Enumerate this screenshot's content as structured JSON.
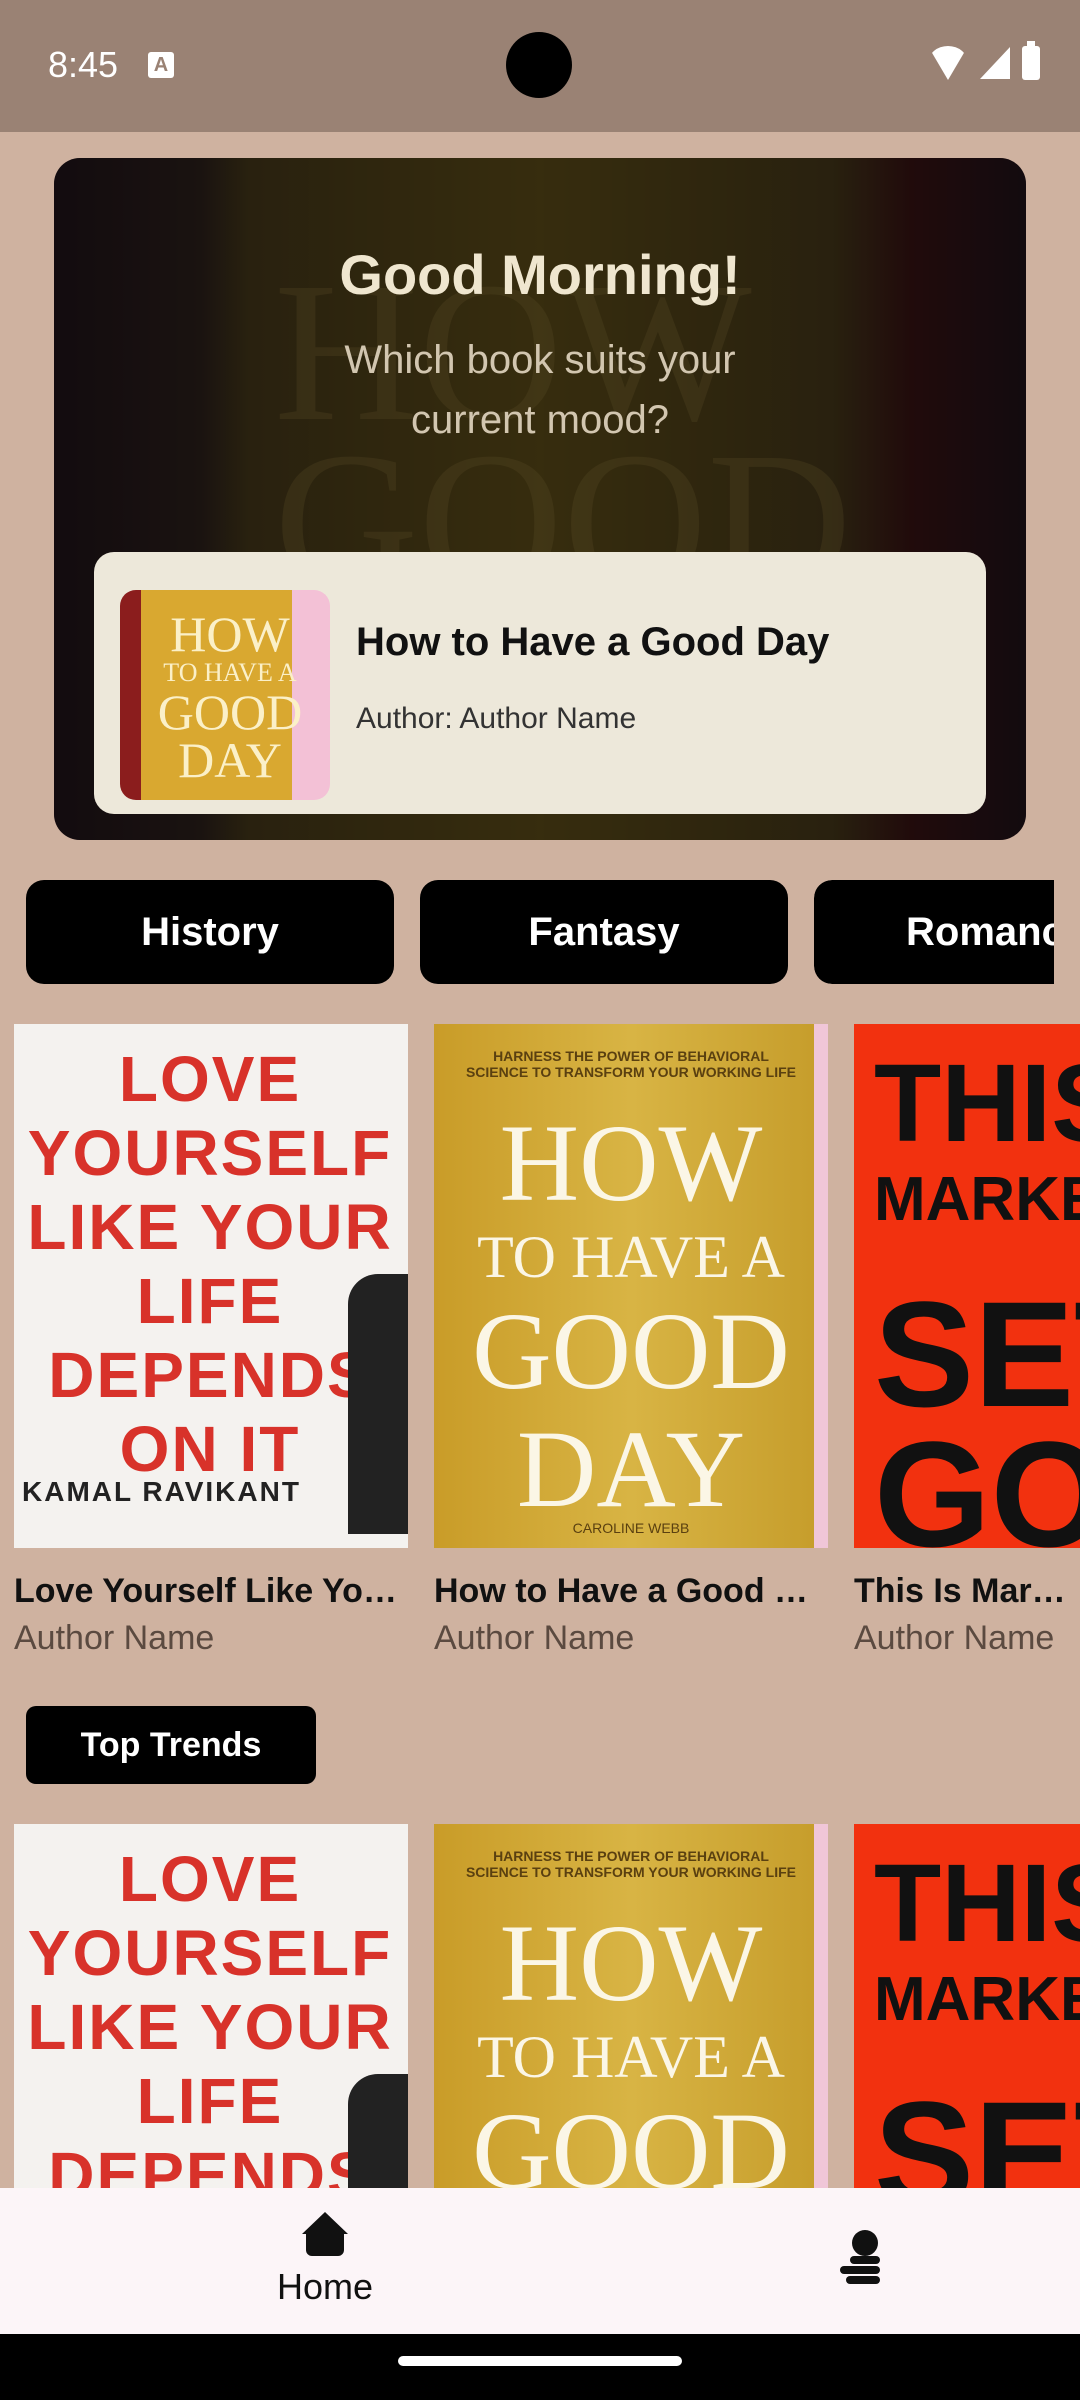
{
  "status_bar": {
    "time": "8:45"
  },
  "hero": {
    "greeting": "Good Morning!",
    "subtitle": "Which book suits your current mood?",
    "featured": {
      "title": "How to Have a Good Day",
      "author": "Author: Author Name"
    }
  },
  "categories": [
    "History",
    "Fantasy",
    "Romance"
  ],
  "books": [
    {
      "title": "Love Yourself Like Your Life Depends on It",
      "author": "Author Name"
    },
    {
      "title": "How to Have a Good Day",
      "author": "Author Name"
    },
    {
      "title": "This Is Marketing",
      "author": "Author Name"
    }
  ],
  "trends_label": "Top Trends",
  "nav": {
    "home_label": "Home"
  },
  "colors": {
    "background": "#cfb2a0",
    "chip": "#000000",
    "nav_background": "#fcf5f8"
  }
}
